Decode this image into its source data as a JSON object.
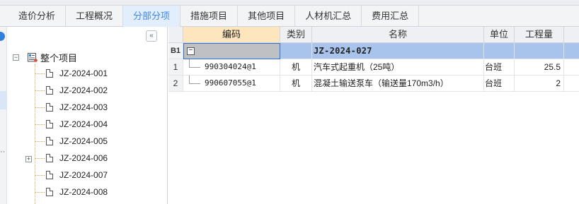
{
  "tabs": [
    {
      "label": "造价分析",
      "active": false
    },
    {
      "label": "工程概况",
      "active": false
    },
    {
      "label": "分部分项",
      "active": true
    },
    {
      "label": "措施项目",
      "active": false
    },
    {
      "label": "其他项目",
      "active": false
    },
    {
      "label": "人材机汇总",
      "active": false
    },
    {
      "label": "费用汇总",
      "active": false
    }
  ],
  "tree": {
    "collapse_glyph": "«",
    "root": {
      "label": "整个项目",
      "expander": "−"
    },
    "items": [
      {
        "label": "JZ-2024-001"
      },
      {
        "label": "JZ-2024-002"
      },
      {
        "label": "JZ-2024-003"
      },
      {
        "label": "JZ-2024-004"
      },
      {
        "label": "JZ-2024-005"
      },
      {
        "label": "JZ-2024-006",
        "expander": "+"
      },
      {
        "label": "JZ-2024-007"
      },
      {
        "label": "JZ-2024-008"
      }
    ]
  },
  "grid": {
    "headers": {
      "code": "编码",
      "type": "类别",
      "name": "名称",
      "unit": "单位",
      "qty": "工程量"
    },
    "group_row": {
      "row_label": "B1",
      "expander": "−",
      "name": "JZ-2024-027"
    },
    "rows": [
      {
        "row_no": "1",
        "code": "990304024@1",
        "type": "机",
        "name": "汽车式起重机（25吨）",
        "unit": "台班",
        "qty": "25.5"
      },
      {
        "row_no": "2",
        "code": "990607055@1",
        "type": "机",
        "name": "混凝土输送泵车（输送量170m3/h）",
        "unit": "台班",
        "qty": "2"
      }
    ]
  },
  "colors": {
    "accent": "#3e86ea",
    "selected_row": "#a9c4ec",
    "code_header": "#fde5bd",
    "tree_line": "#e5a64b"
  }
}
